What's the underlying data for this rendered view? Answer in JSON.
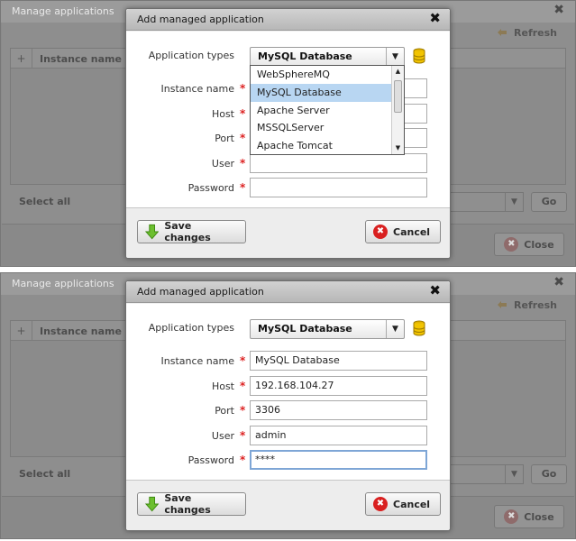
{
  "background": {
    "title": "Manage applications",
    "refresh_label": "Refresh",
    "column_instance_name": "Instance name",
    "add_symbol": "+",
    "select_all_label": "Select all",
    "go_label": "Go",
    "close_label": "Close"
  },
  "dialog": {
    "title": "Add managed application",
    "close_symbol": "✖",
    "labels": {
      "application_types": "Application types",
      "instance_name": "Instance name",
      "host": "Host",
      "port": "Port",
      "user": "User",
      "password": "Password"
    },
    "required_marker": "*",
    "save_label": "Save changes",
    "cancel_label": "Cancel"
  },
  "panel1": {
    "application_type": "MySQL Database",
    "dropdown_options": [
      "WebSphereMQ",
      "MySQL Database",
      "Apache Server",
      "MSSQLServer",
      "Apache Tomcat"
    ],
    "dropdown_selected_index": 1,
    "values": {
      "instance_name": "",
      "host": "",
      "port": "",
      "user": "",
      "password": ""
    }
  },
  "panel2": {
    "application_type": "MySQL Database",
    "values": {
      "instance_name": "MySQL Database",
      "host": "192.168.104.27",
      "port": "3306",
      "user": "admin",
      "password": "****"
    }
  },
  "colors": {
    "required": "#dd2222",
    "selected_option": "#b8d6f2",
    "focus_border": "#7ea6d6",
    "cancel_icon": "#d92020",
    "save_icon": "#6cbf2f"
  }
}
